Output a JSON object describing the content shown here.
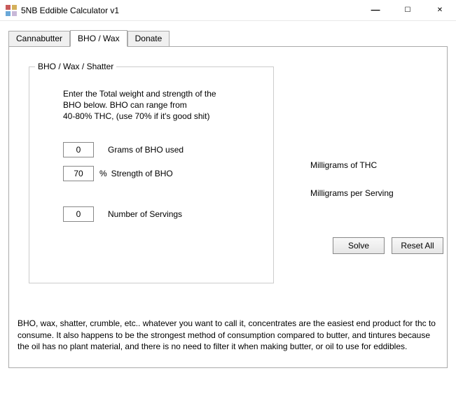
{
  "window": {
    "title": "5NB Eddible Calculator v1"
  },
  "tabs": {
    "items": [
      {
        "label": "Cannabutter"
      },
      {
        "label": "BHO / Wax"
      },
      {
        "label": "Donate"
      }
    ]
  },
  "groupbox": {
    "title": "BHO / Wax / Shatter",
    "instructions_line1": "Enter the Total weight and strength of the",
    "instructions_line2": "BHO below. BHO can range from",
    "instructions_line3": "40-80% THC, (use 70% if it's good shit)"
  },
  "inputs": {
    "grams": {
      "value": "0",
      "label": "Grams of BHO used"
    },
    "strength": {
      "value": "70",
      "percent_symbol": "%",
      "label": "Strength of BHO"
    },
    "servings": {
      "value": "0",
      "label": "Number of Servings"
    }
  },
  "results": {
    "thc_label": "Milligrams of THC",
    "serving_label": "Milligrams per Serving"
  },
  "buttons": {
    "solve": "Solve",
    "reset": "Reset All"
  },
  "footer": "BHO, wax, shatter, crumble, etc.. whatever you want to call it, concentrates are the easiest end product for thc to consume. It also happens to be the strongest method of consumption compared to butter, and tintures because the oil has no plant material, and there is no need to filter it when making butter, or oil to use for eddibles."
}
